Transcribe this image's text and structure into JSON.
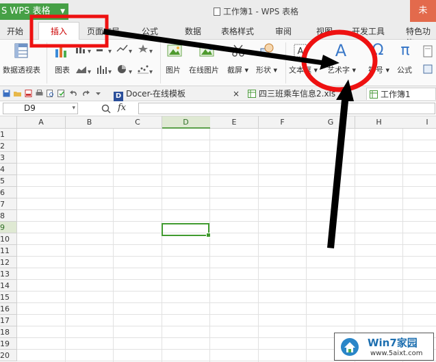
{
  "titlebar": {
    "app_label": "S WPS 表格",
    "title": "工作簿1 - WPS 表格",
    "login_label": "未"
  },
  "ribbon_tabs": [
    "开始",
    "插入",
    "页面布局",
    "公式",
    "数据",
    "表格样式",
    "审阅",
    "视图",
    "开发工具",
    "特色功能"
  ],
  "active_tab": "插入",
  "ribbon": {
    "pivot_label": "数据透视表",
    "chart_label": "图表",
    "picture_label": "图片",
    "online_picture_label": "在线图片",
    "screenshot_label": "截屏",
    "shapes_label": "形状",
    "textbox_label": "文本框",
    "wordart_label": "艺术字",
    "symbol_label": "符号",
    "formula_label": "公式",
    "wordart_glyph": "A",
    "symbol_glyph": "Ω",
    "formula_glyph": "π",
    "dropdown_glyph": "▾"
  },
  "doc_tabs": {
    "template_tab": "Docer-在线模板",
    "close_glyph": "×",
    "file_tab": "四三班乘车信息2.xls",
    "workbook_tab": "工作簿1"
  },
  "formula_bar": {
    "name_box": "D9",
    "fx_label": "fx",
    "formula_value": ""
  },
  "sheet": {
    "columns": [
      "A",
      "B",
      "C",
      "D",
      "E",
      "F",
      "G",
      "H",
      "I"
    ],
    "rows": [
      "1",
      "2",
      "3",
      "4",
      "5",
      "6",
      "7",
      "8",
      "9",
      "10",
      "11",
      "12",
      "13",
      "14",
      "15",
      "16",
      "17",
      "18",
      "19",
      "20"
    ],
    "selected_cell": "D9",
    "selected_column": "D",
    "selected_row": "9"
  },
  "annotation": {
    "highlight_color": "#ee1111",
    "arrow_color": "#000000"
  },
  "watermark": {
    "title": "Win7家园",
    "url": "www.5aixt.com"
  }
}
